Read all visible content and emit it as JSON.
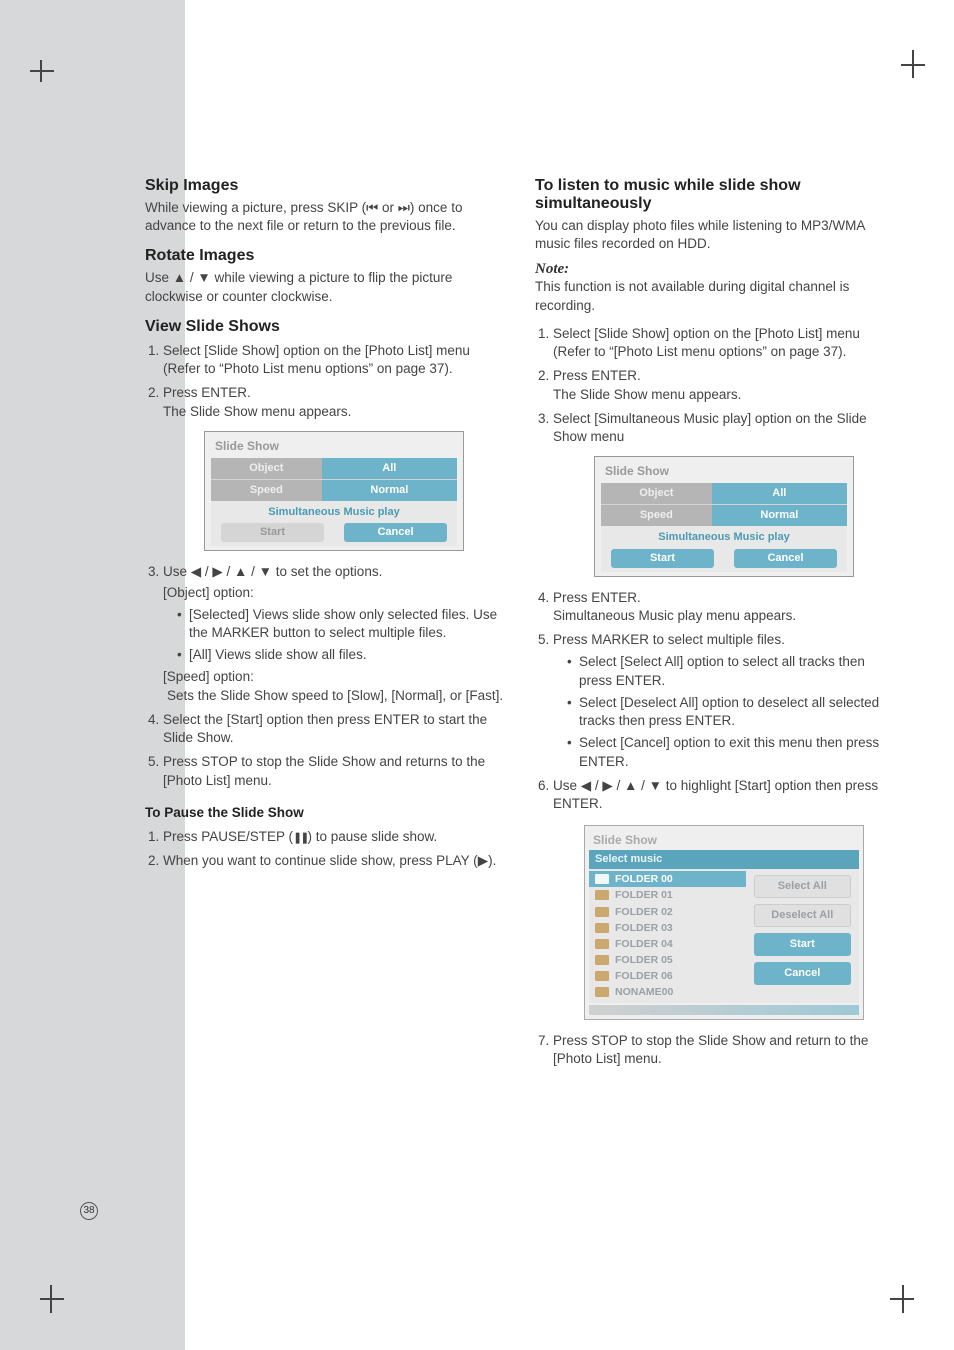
{
  "page_number": "38",
  "left": {
    "h_skip": "Skip Images",
    "skip_text_a": "While viewing a picture, press SKIP (",
    "skip_text_b": " or ",
    "skip_text_c": ") once to advance to the next file or return to the previous file.",
    "h_rotate": "Rotate Images",
    "rotate_text_a": "Use ",
    "rotate_text_b": " / ",
    "rotate_text_c": " while viewing a picture to flip the picture clockwise or counter clockwise.",
    "h_view": "View Slide Shows",
    "view_1": "Select [Slide Show] option on the [Photo List] menu (Refer to “Photo List menu options” on page 37).",
    "view_2a": "Press ENTER.",
    "view_2b": "The Slide Show menu appears.",
    "view_3a": "Use ◀ / ▶ / ▲ / ▼ to set the options.",
    "view_3_obj": "[Object] option:",
    "view_3_obj_b1": "[Selected] Views slide show only selected files. Use the MARKER button to select multiple files.",
    "view_3_obj_b2": "[All] Views slide show all files.",
    "view_3_spd": "[Speed] option:",
    "view_3_spd_t": "Sets the Slide Show speed to [Slow], [Normal], or [Fast].",
    "view_4": "Select the [Start] option then press ENTER to start the Slide Show.",
    "view_5": "Press STOP to stop the Slide Show and returns to the [Photo List] menu.",
    "h_pause": "To Pause the Slide Show",
    "pause_1a": "Press PAUSE/STEP (",
    "pause_1b": ") to pause slide show.",
    "pause_2a": "When you want to continue slide show, press PLAY (",
    "pause_2b": ")."
  },
  "right": {
    "h_listen": "To listen to music while slide show simultaneously",
    "listen_p": "You can display photo files while listening to MP3/WMA music files recorded on HDD.",
    "note_label": "Note:",
    "note_text": "This function is not available during digital channel is recording.",
    "l1": "Select [Slide Show] option on the [Photo List] menu (Refer to “[Photo List menu options” on page 37).",
    "l2a": "Press ENTER.",
    "l2b": "The Slide Show menu appears.",
    "l3": "Select [Simultaneous Music play] option on the Slide Show menu",
    "l4a": "Press ENTER.",
    "l4b": "Simultaneous Music play menu appears.",
    "l5": "Press MARKER to select multiple files.",
    "l5_b1": "Select [Select All] option to select all tracks then press ENTER.",
    "l5_b2": "Select [Deselect All] option to deselect all selected tracks then press ENTER.",
    "l5_b3": "Select [Cancel] option to exit this menu then press ENTER.",
    "l6": "Use ◀ / ▶ / ▲ / ▼ to highlight [Start] option then press ENTER.",
    "l7": "Press STOP to stop the Slide Show and return to the [Photo List] menu."
  },
  "ui1": {
    "title": "Slide Show",
    "row1l": "Object",
    "row1r": "All",
    "row2l": "Speed",
    "row2r": "Normal",
    "sim": "Simultaneous Music play",
    "start": "Start",
    "cancel": "Cancel"
  },
  "ui2": {
    "title": "Slide Show",
    "row1l": "Object",
    "row1r": "All",
    "row2l": "Speed",
    "row2r": "Normal",
    "sim": "Simultaneous Music play",
    "start": "Start",
    "cancel": "Cancel"
  },
  "ui3": {
    "title": "Slide Show",
    "subtitle": "Select music",
    "folders": [
      "FOLDER 00",
      "FOLDER 01",
      "FOLDER 02",
      "FOLDER 03",
      "FOLDER 04",
      "FOLDER 05",
      "FOLDER 06",
      "NONAME00"
    ],
    "sel_index": 0,
    "actions": {
      "select_all": "Select All",
      "deselect_all": "Deselect All",
      "start": "Start",
      "cancel": "Cancel"
    }
  },
  "glyphs": {
    "prev": "⏮",
    "next": "⏭",
    "up": "▲",
    "down": "▼",
    "pause": "❚❚",
    "play": "▶"
  }
}
